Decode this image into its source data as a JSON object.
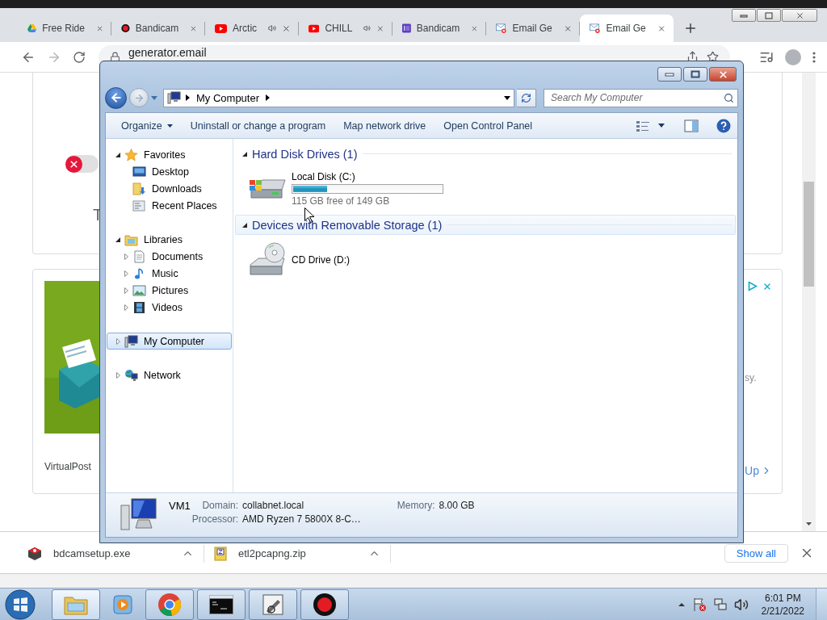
{
  "browser": {
    "tabs": [
      {
        "title": "Free Ride",
        "kind": "drive",
        "audio": false,
        "selected": false
      },
      {
        "title": "Bandicam",
        "kind": "record",
        "audio": false,
        "selected": false
      },
      {
        "title": "Arctic",
        "kind": "youtube",
        "audio": true,
        "selected": false
      },
      {
        "title": "CHILL",
        "kind": "youtube",
        "audio": true,
        "selected": false
      },
      {
        "title": "Bandicam",
        "kind": "list",
        "audio": false,
        "selected": false
      },
      {
        "title": "Email Ge",
        "kind": "mail",
        "audio": false,
        "selected": false
      },
      {
        "title": "Email Ge",
        "kind": "mail",
        "audio": false,
        "selected": true
      }
    ],
    "address": "generator.email"
  },
  "page": {
    "toggle": {
      "on": false
    },
    "heading_fragment": "T",
    "ad_caption": "VirtualPost",
    "ad_text_fragment": "sy.",
    "ad_link_fragment": "Up"
  },
  "explorer": {
    "nav": {
      "back_enabled": true,
      "forward_enabled": false
    },
    "breadcrumb": [
      "My Computer"
    ],
    "search": {
      "placeholder": "Search My Computer"
    },
    "toolbar": [
      {
        "label": "Organize",
        "dropdown": true
      },
      {
        "label": "Uninstall or change a program",
        "dropdown": false
      },
      {
        "label": "Map network drive",
        "dropdown": false
      },
      {
        "label": "Open Control Panel",
        "dropdown": false
      }
    ],
    "sidebar": {
      "items": [
        {
          "label": "Favorites",
          "kind": "star",
          "expanded": true,
          "selected": false,
          "children": [
            {
              "label": "Desktop",
              "kind": "desktop",
              "selected": false
            },
            {
              "label": "Downloads",
              "kind": "downloads",
              "selected": false
            },
            {
              "label": "Recent Places",
              "kind": "recent",
              "selected": false
            }
          ]
        },
        {
          "label": "Libraries",
          "kind": "libraries",
          "expanded": true,
          "selected": false,
          "children": [
            {
              "label": "Documents",
              "kind": "documents",
              "expanded": false,
              "selected": false
            },
            {
              "label": "Music",
              "kind": "music",
              "expanded": false,
              "selected": false
            },
            {
              "label": "Pictures",
              "kind": "pictures",
              "expanded": false,
              "selected": false
            },
            {
              "label": "Videos",
              "kind": "videos",
              "expanded": false,
              "selected": false
            }
          ]
        },
        {
          "label": "My Computer",
          "kind": "computer",
          "expanded": false,
          "selected": true
        },
        {
          "label": "Network",
          "kind": "network",
          "expanded": false,
          "selected": false
        }
      ]
    },
    "sections": [
      {
        "title": "Hard Disk Drives (1)",
        "expanded": true,
        "highlighted": false,
        "items": [
          {
            "kind": "disk",
            "name": "Local Disk (C:)",
            "level": 0.23,
            "free": "115 GB free of 149 GB"
          }
        ]
      },
      {
        "title": "Devices with Removable Storage (1)",
        "expanded": true,
        "highlighted": true,
        "items": [
          {
            "kind": "cd",
            "name": "CD Drive (D:)"
          }
        ]
      }
    ],
    "details": {
      "name": "VM1",
      "fields": [
        {
          "label": "Domain:",
          "value": "collabnet.local"
        },
        {
          "label": "Memory:",
          "value": "8.00 GB"
        },
        {
          "label": "Processor:",
          "value": "AMD Ryzen 7 5800X 8-C…"
        }
      ]
    }
  },
  "downloads": {
    "items": [
      {
        "name": "bdcamsetup.exe",
        "kind": "exe"
      },
      {
        "name": "etl2pcapng.zip",
        "kind": "zip"
      }
    ],
    "show_all": "Show all"
  },
  "taskbar": {
    "items": [
      {
        "kind": "explorer",
        "running": true,
        "selected": true
      },
      {
        "kind": "media",
        "running": false,
        "selected": false
      },
      {
        "kind": "chrome",
        "running": true,
        "selected": false
      },
      {
        "kind": "cmd",
        "running": true,
        "selected": false
      },
      {
        "kind": "paint",
        "running": true,
        "selected": false
      },
      {
        "kind": "record",
        "running": true,
        "selected": false
      }
    ],
    "time": "6:01 PM",
    "date": "2/21/2022"
  }
}
